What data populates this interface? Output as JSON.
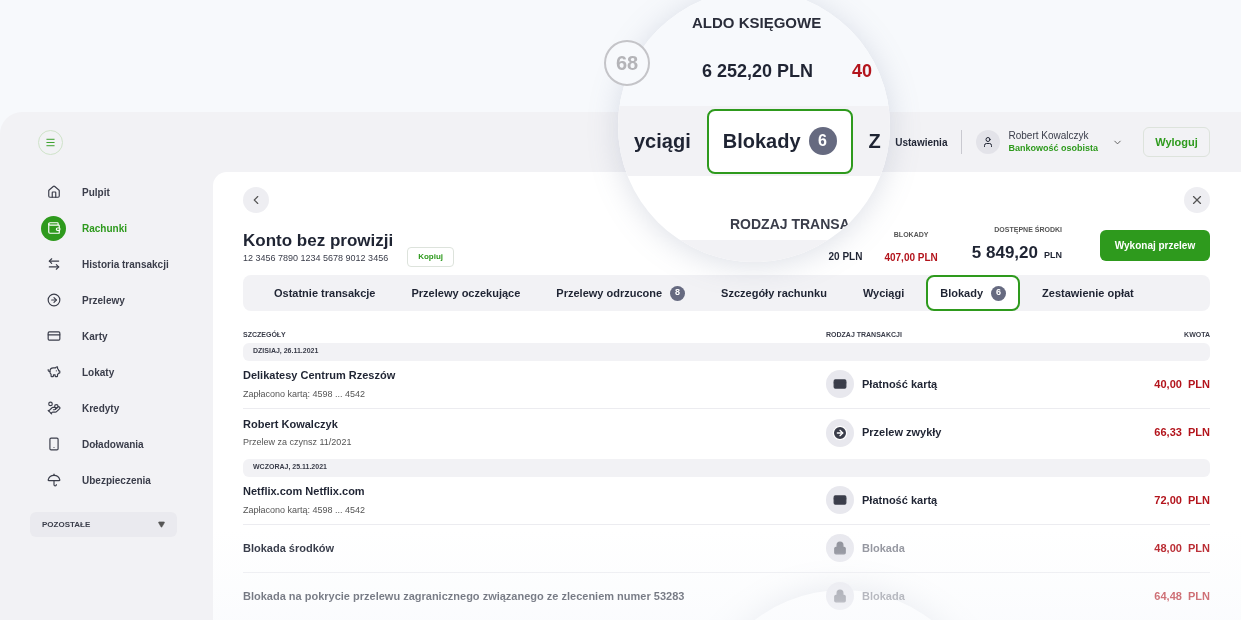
{
  "step_badge": "68",
  "magnifier": {
    "heading": "ALDO KSIĘGOWE",
    "amount": "6 252,20 PLN",
    "amount_cut": "40",
    "tabs": [
      {
        "label": "yciągi",
        "selected": false
      },
      {
        "label": "Blokady",
        "count": "6",
        "selected": true
      },
      {
        "label": "Z",
        "selected": false
      }
    ],
    "column": "RODZAJ TRANSA"
  },
  "header": {
    "settings": "Ustawienia",
    "user_name": "Robert Kowalczyk",
    "user_role": "Bankowość osobista",
    "logout": "Wyloguj"
  },
  "sidebar": {
    "items": [
      {
        "label": "Pulpit",
        "selected": false
      },
      {
        "label": "Rachunki",
        "selected": true
      },
      {
        "label": "Historia transakcji",
        "selected": false
      },
      {
        "label": "Przelewy",
        "selected": false
      },
      {
        "label": "Karty",
        "selected": false
      },
      {
        "label": "Lokaty",
        "selected": false
      },
      {
        "label": "Kredyty",
        "selected": false
      },
      {
        "label": "Doładowania",
        "selected": false
      },
      {
        "label": "Ubezpieczenia",
        "selected": false
      }
    ],
    "more": "POZOSTAŁE"
  },
  "account": {
    "title": "Konto bez prowizji",
    "number": "12 3456 7890 1234 5678 9012 3456",
    "copy": "Kopiuj",
    "balance_cut": "20 PLN",
    "blocked_label": "BLOKADY",
    "blocked": "407,00 PLN",
    "available_label": "DOSTĘPNE ŚRODKI",
    "available": "5 849,20",
    "available_currency": "PLN",
    "transfer": "Wykonaj przelew"
  },
  "tabs": [
    {
      "label": "Ostatnie transakcje",
      "selected": false
    },
    {
      "label": "Przelewy oczekujące",
      "selected": false
    },
    {
      "label": "Przelewy odrzucone",
      "count": "8",
      "selected": false
    },
    {
      "label": "Szczegóły rachunku",
      "selected": false
    },
    {
      "label": "Wyciągi",
      "selected": false
    },
    {
      "label": "Blokady",
      "count": "6",
      "selected": true
    },
    {
      "label": "Zestawienie opłat",
      "selected": false
    }
  ],
  "table": {
    "columns": [
      "SZCZEGÓŁY",
      "RODZAJ TRANSAKCJI",
      "KWOTA"
    ],
    "groups": [
      {
        "date": "DZISIAJ, 26.11.2021",
        "rows": [
          {
            "title": "Delikatesy Centrum Rzeszów",
            "subtitle": "Zapłacono kartą:  4598 ... 4542",
            "kind": "card",
            "type": "Płatność kartą",
            "amount": "40,00  PLN"
          },
          {
            "title": "Robert Kowalczyk",
            "subtitle": "Przelew za czynsz 11/2021",
            "kind": "transfer",
            "type": "Przelew zwykły",
            "amount": "66,33  PLN"
          }
        ]
      },
      {
        "date": "WCZORAJ, 25.11.2021",
        "rows": [
          {
            "title": "Netflix.com Netflix.com",
            "subtitle": "Zapłacono kartą:  4598 ... 4542",
            "kind": "card",
            "type": "Płatność kartą",
            "amount": "72,00  PLN"
          },
          {
            "title": "Blokada środków",
            "kind": "lock",
            "type": "Blokada",
            "amount": "48,00  PLN"
          },
          {
            "title": "Blokada na pokrycie przelewu zagranicznego związanego ze zleceniem numer 53283",
            "kind": "lock",
            "type": "Blokada",
            "amount": "64,48  PLN"
          }
        ]
      }
    ]
  }
}
